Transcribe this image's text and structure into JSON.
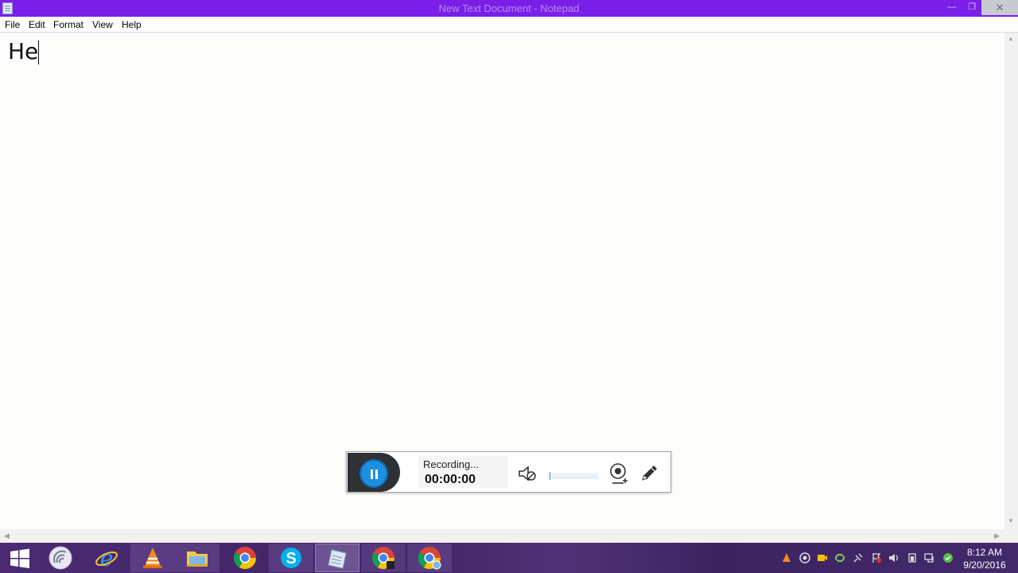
{
  "window": {
    "title": "New Text Document - Notepad",
    "minimize": "—",
    "maximize": "❐",
    "close": "✕"
  },
  "menu": [
    "File",
    "Edit",
    "Format",
    "View",
    "Help"
  ],
  "editor": {
    "content": "He"
  },
  "recorder": {
    "status": "Recording...",
    "time": "00:00:00",
    "audio_icon": "speaker-muted-icon",
    "webcam_icon": "webcam-add-icon",
    "pen_icon": "pencil-icon",
    "pause_color": "#1c8fde"
  },
  "taskbar": {
    "apps": [
      {
        "name": "Start",
        "icon": "windows-logo-icon"
      },
      {
        "name": "Torrent client",
        "icon": "torrent-icon"
      },
      {
        "name": "Internet Explorer",
        "icon": "ie-icon"
      },
      {
        "name": "VLC media player",
        "icon": "vlc-icon"
      },
      {
        "name": "File Explorer",
        "icon": "folder-icon"
      },
      {
        "name": "Google Chrome",
        "icon": "chrome-icon"
      },
      {
        "name": "Skype",
        "icon": "skype-icon"
      },
      {
        "name": "Notepad",
        "icon": "notepad-icon"
      },
      {
        "name": "Chrome window",
        "icon": "chrome-icon"
      },
      {
        "name": "Chrome profile window",
        "icon": "chrome-icon"
      }
    ],
    "clock_time": "8:12 AM",
    "clock_date": "9/20/2016",
    "accent_color": "#7a1fe8"
  }
}
